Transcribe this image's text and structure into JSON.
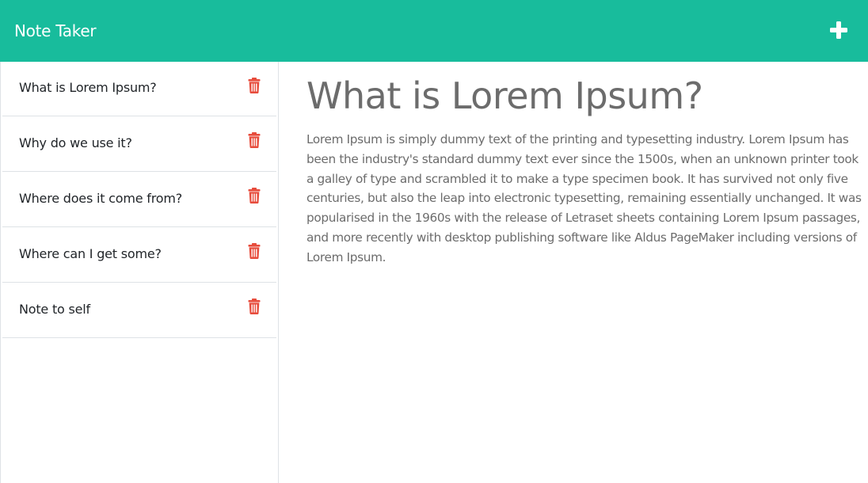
{
  "app": {
    "title": "Note Taker",
    "accent_color": "#18bc9c",
    "add_icon": "plus-icon",
    "delete_icon": "trash-icon",
    "delete_color": "#e74c3c"
  },
  "notes": [
    {
      "title": "What is Lorem Ipsum?"
    },
    {
      "title": "Why do we use it?"
    },
    {
      "title": "Where does it come from?"
    },
    {
      "title": "Where can I get some?"
    },
    {
      "title": "Note to self"
    }
  ],
  "active_note": {
    "title": "What is Lorem Ipsum?",
    "text": "Lorem Ipsum is simply dummy text of the printing and typesetting industry. Lorem Ipsum has been the industry's standard dummy text ever since the 1500s, when an unknown printer took a galley of type and scrambled it to make a type specimen book. It has survived not only five centuries, but also the leap into electronic typesetting, remaining essentially unchanged. It was popularised in the 1960s with the release of Letraset sheets containing Lorem Ipsum passages, and more recently with desktop publishing software like Aldus PageMaker including versions of Lorem Ipsum."
  }
}
